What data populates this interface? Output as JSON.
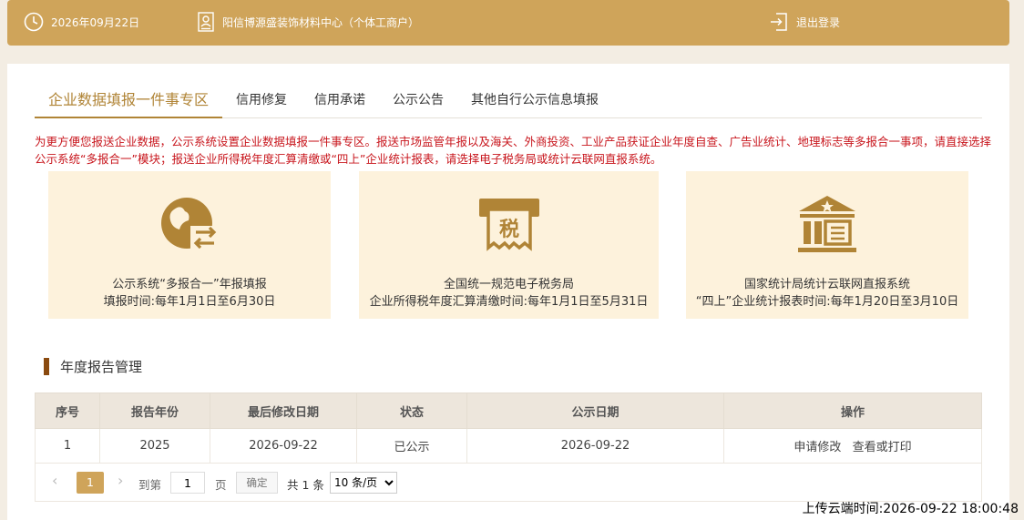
{
  "header": {
    "date": "2026年09月22日",
    "company": "阳信博源盛装饰材料中心（个体工商户）",
    "logout_label": "退出登录"
  },
  "tabs": [
    {
      "label": "企业数据填报一件事专区",
      "active": true
    },
    {
      "label": "信用修复"
    },
    {
      "label": "信用承诺"
    },
    {
      "label": "公示公告"
    },
    {
      "label": "其他自行公示信息填报"
    }
  ],
  "notice": "为更方便您报送企业数据，公示系统设置企业数据填报一件事专区。报送市场监管年报以及海关、外商投资、工业产品获证企业年度自查、广告业统计、地理标志等多报合一事项，请直接选择公示系统“多报合一”模块；报送企业所得税年度汇算清缴或“四上”企业统计报表，请选择电子税务局或统计云联网直报系统。",
  "cards": [
    {
      "icon": "globe-exchange-icon",
      "line1": "公示系统“多报合一”年报填报",
      "line2": "填报时间:每年1月1日至6月30日"
    },
    {
      "icon": "tax-receipt-icon",
      "icon_text": "税",
      "line1": "全国统一规范电子税务局",
      "line2": "企业所得税年度汇算清缴时间:每年1月1日至5月31日"
    },
    {
      "icon": "statistics-building-icon",
      "line1": "国家统计局统计云联网直报系统",
      "line2": "“四上”企业统计报表时间:每年1月20日至3月10日"
    }
  ],
  "section": {
    "title": "年度报告管理"
  },
  "table": {
    "headers": [
      "序号",
      "报告年份",
      "最后修改日期",
      "状态",
      "公示日期",
      "操作"
    ],
    "rows": [
      {
        "index": "1",
        "year": "2025",
        "modified": "2026-09-22",
        "status": "已公示",
        "publish_date": "2026-09-22",
        "actions": [
          "申请修改",
          "查看或打印"
        ]
      }
    ]
  },
  "pager": {
    "current_page": "1",
    "goto_label": "到第",
    "goto_value": "1",
    "page_label": "页",
    "confirm_label": "确定",
    "total": "共 1 条",
    "page_size": "10 条/页"
  },
  "upload_time": "上传云端时间:2026-09-22 18:00:48",
  "colors": {
    "accent": "#cfa45a",
    "notice": "#c8161d",
    "card_bg": "#fdf2dc",
    "icon": "#b08436"
  }
}
